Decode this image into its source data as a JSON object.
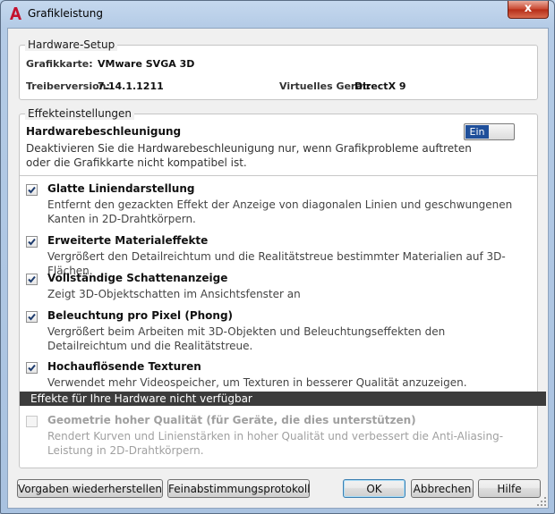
{
  "window": {
    "title": "Grafikleistung",
    "close_glyph": "x"
  },
  "hardware": {
    "legend": "Hardware-Setup",
    "card_label": "Grafikkarte:",
    "card_value": "VMware SVGA 3D",
    "driver_label": "Treiberversion:",
    "driver_value": "7.14.1.1211",
    "virtual_label": "Virtuelles Gerät:",
    "virtual_value": "DirectX 9"
  },
  "effects": {
    "legend": "Effekteinstellungen",
    "accel_title": "Hardwarebeschleunigung",
    "accel_desc": "Deaktivieren Sie die Hardwarebeschleunigung nur, wenn Grafikprobleme auftreten oder die Grafikkarte nicht kompatibel ist.",
    "toggle_label": "Ein",
    "options": [
      {
        "title": "Glatte Liniendarstellung",
        "desc": "Entfernt den gezackten Effekt der Anzeige von diagonalen Linien und geschwungenen Kanten in 2D-Drahtkörpern.",
        "checked": true
      },
      {
        "title": "Erweiterte Materialeffekte",
        "desc": "Vergrößert den Detailreichtum und die Realitätstreue bestimmter Materialien auf 3D-Flächen.",
        "checked": true
      },
      {
        "title": "Vollständige Schattenanzeige",
        "desc": "Zeigt 3D-Objektschatten im Ansichtsfenster an",
        "checked": true
      },
      {
        "title": "Beleuchtung pro Pixel (Phong)",
        "desc": "Vergrößert beim Arbeiten mit 3D-Objekten und Beleuchtungseffekten den Detailreichtum und die Realitätstreue.",
        "checked": true
      },
      {
        "title": "Hochauflösende Texturen",
        "desc": "Verwendet mehr Videospeicher, um Texturen in besserer Qualität anzuzeigen.",
        "checked": true
      }
    ],
    "unavailable_header": "Effekte für Ihre Hardware nicht verfügbar",
    "unavailable_option": {
      "title": "Geometrie hoher Qualität (für Geräte, die dies unterstützen)",
      "desc": "Rendert Kurven und Linienstärken in hoher Qualität und verbessert die Anti-Aliasing-Leistung in 2D-Drahtkörpern.",
      "checked": false
    }
  },
  "buttons": {
    "restore": "Vorgaben wiederherstellen",
    "tuning_log": "Feinabstimmungsprotokoll",
    "ok": "OK",
    "cancel": "Abbrechen",
    "help": "Hilfe"
  }
}
